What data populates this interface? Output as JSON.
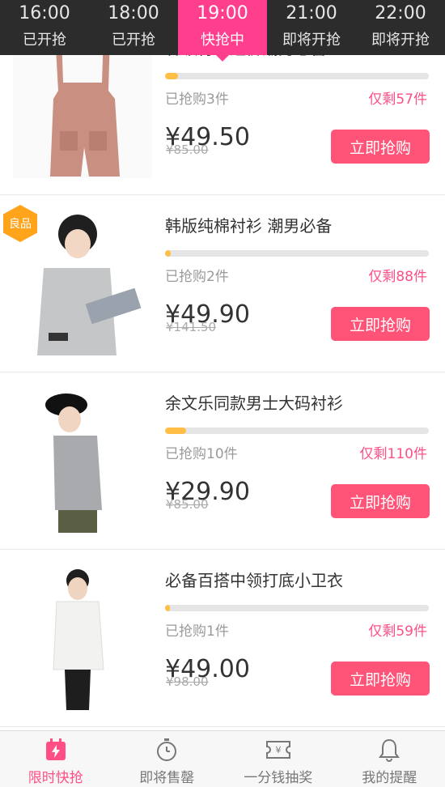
{
  "time_slots": [
    {
      "time": "16:00",
      "status": "已开抢"
    },
    {
      "time": "18:00",
      "status": "已开抢"
    },
    {
      "time": "19:00",
      "status": "快抢中"
    },
    {
      "time": "21:00",
      "status": "即将开抢"
    },
    {
      "time": "22:00",
      "status": "即将开抢"
    }
  ],
  "products": [
    {
      "title": "甘领背带短裤潮男必备",
      "sold": "已抢购3件",
      "remaining": "仅剩57件",
      "progress": 0.05,
      "price": "¥49.50",
      "original_price": "¥85.00",
      "button": "立即抢购"
    },
    {
      "title": "韩版纯棉衬衫 潮男必备",
      "sold": "已抢购2件",
      "remaining": "仅剩88件",
      "progress": 0.02,
      "price": "¥49.90",
      "original_price": "¥141.50",
      "button": "立即抢购",
      "badge": "良品"
    },
    {
      "title": "余文乐同款男士大码衬衫",
      "sold": "已抢购10件",
      "remaining": "仅剩110件",
      "progress": 0.08,
      "price": "¥29.90",
      "original_price": "¥85.00",
      "button": "立即抢购"
    },
    {
      "title": "必备百搭中领打底小卫衣",
      "sold": "已抢购1件",
      "remaining": "仅剩59件",
      "progress": 0.017,
      "price": "¥49.00",
      "original_price": "¥98.00",
      "button": "立即抢购"
    }
  ],
  "tabs": [
    {
      "label": "限时快抢",
      "icon": "flash-sale-icon"
    },
    {
      "label": "即将售罄",
      "icon": "stopwatch-icon"
    },
    {
      "label": "一分钱抽奖",
      "icon": "ticket-icon"
    },
    {
      "label": "我的提醒",
      "icon": "bell-icon"
    }
  ],
  "colors": {
    "accent": "#ff3f8e",
    "button": "#ff5478",
    "progress": "#ffbf47",
    "badge": "#ffa41b"
  }
}
